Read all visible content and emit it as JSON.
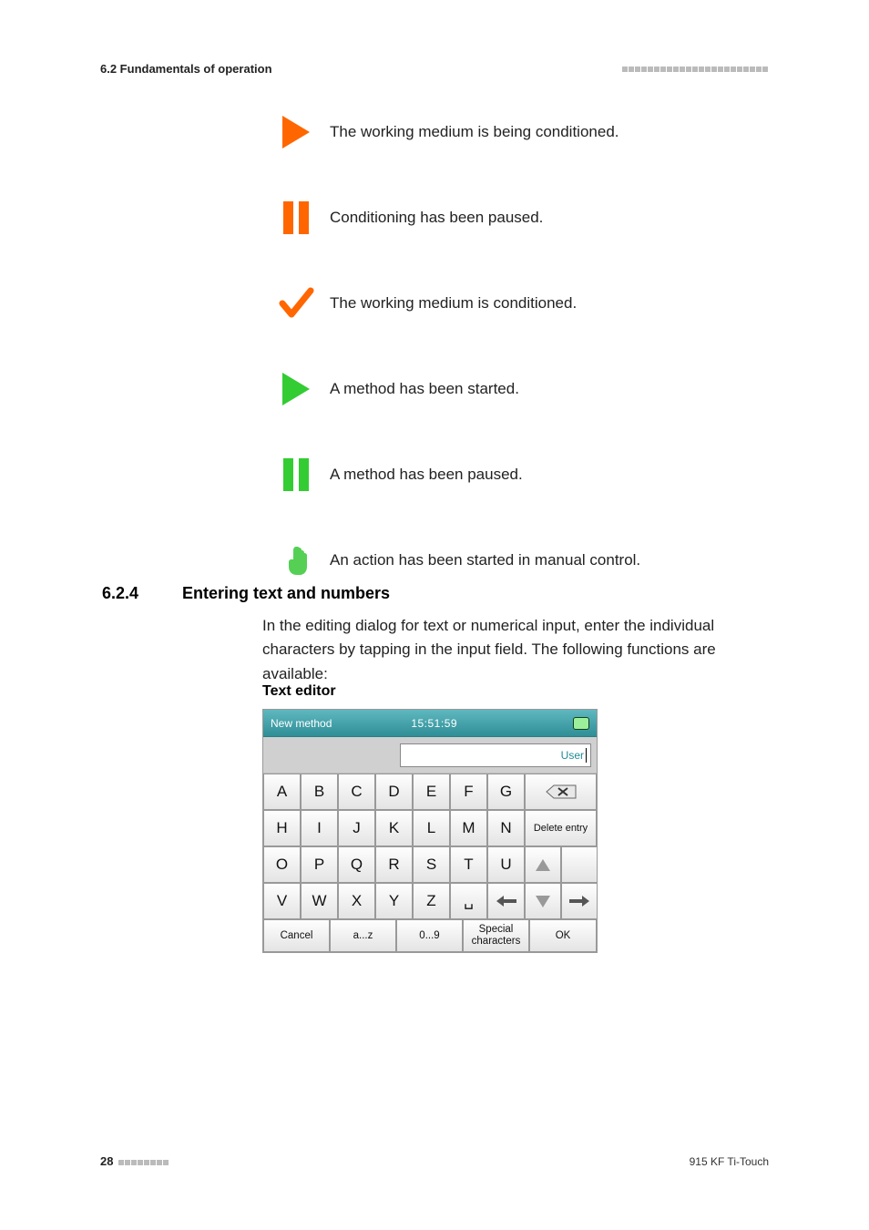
{
  "header": {
    "breadcrumb": "6.2 Fundamentals of operation"
  },
  "legend": {
    "items": [
      {
        "icon": "play-orange",
        "text": "The working medium is being conditioned."
      },
      {
        "icon": "pause-orange",
        "text": "Conditioning has been paused."
      },
      {
        "icon": "check-orange",
        "text": "The working medium is conditioned."
      },
      {
        "icon": "play-green",
        "text": "A method has been started."
      },
      {
        "icon": "pause-green",
        "text": "A method has been paused."
      },
      {
        "icon": "hand-green",
        "text": "An action has been started in manual control."
      }
    ]
  },
  "section": {
    "number": "6.2.4",
    "title": "Entering text and numbers",
    "para": "In the editing dialog for text or numerical input, enter the individual characters by tapping in the input field. The following functions are available:",
    "subheading": "Text editor"
  },
  "keyboard": {
    "titlebar": {
      "title": "New method",
      "time": "15:51:59"
    },
    "input_label": "User",
    "rows": {
      "r1": [
        "A",
        "B",
        "C",
        "D",
        "E",
        "F",
        "G"
      ],
      "r2": [
        "H",
        "I",
        "J",
        "K",
        "L",
        "M",
        "N"
      ],
      "r3": [
        "O",
        "P",
        "Q",
        "R",
        "S",
        "T",
        "U"
      ],
      "r4": [
        "V",
        "W",
        "X",
        "Y",
        "Z"
      ]
    },
    "func": {
      "backspace_icon": "backspace-icon",
      "delete_entry": "Delete entry",
      "space_label": "␣"
    },
    "footer": {
      "cancel": "Cancel",
      "lower": "a...z",
      "digits": "0...9",
      "special": "Special characters",
      "ok": "OK"
    }
  },
  "footer": {
    "page": "28",
    "product": "915 KF Ti-Touch"
  }
}
